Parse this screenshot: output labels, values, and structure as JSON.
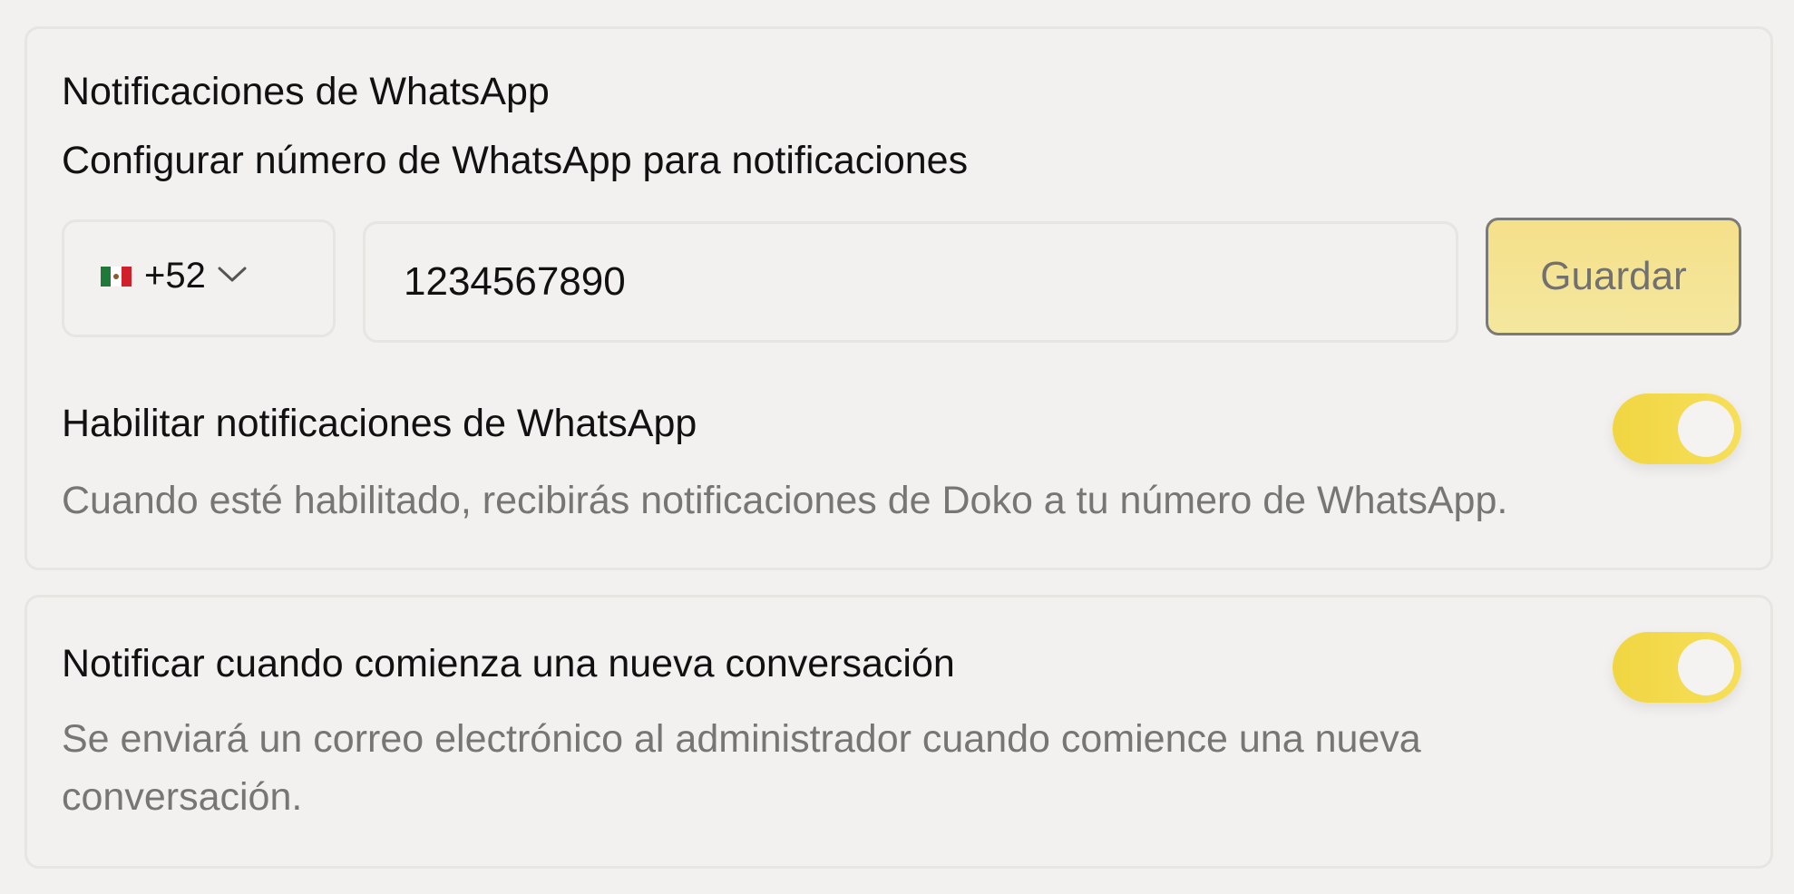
{
  "whatsapp_section": {
    "title": "Notificaciones de WhatsApp",
    "subtitle": "Configurar número de WhatsApp para notificaciones",
    "country_select": {
      "flag_icon": "mexico-flag-icon",
      "dial_code": "+52"
    },
    "phone_input": {
      "value": "1234567890",
      "placeholder": ""
    },
    "save_label": "Guardar",
    "enable_toggle": {
      "label": "Habilitar notificaciones de WhatsApp",
      "description": "Cuando esté habilitado, recibirás notificaciones de Doko a tu número de WhatsApp.",
      "enabled": true
    }
  },
  "conversation_section": {
    "label": "Notificar cuando comienza una nueva conversación",
    "description": "Se enviará un correo electrónico al administrador cuando comience una nueva conversación.",
    "enabled": true
  },
  "colors": {
    "accent": "#f1d642",
    "button_bg": "#f5e08a",
    "card_border": "#e6e5e2",
    "muted_text": "#777674"
  }
}
